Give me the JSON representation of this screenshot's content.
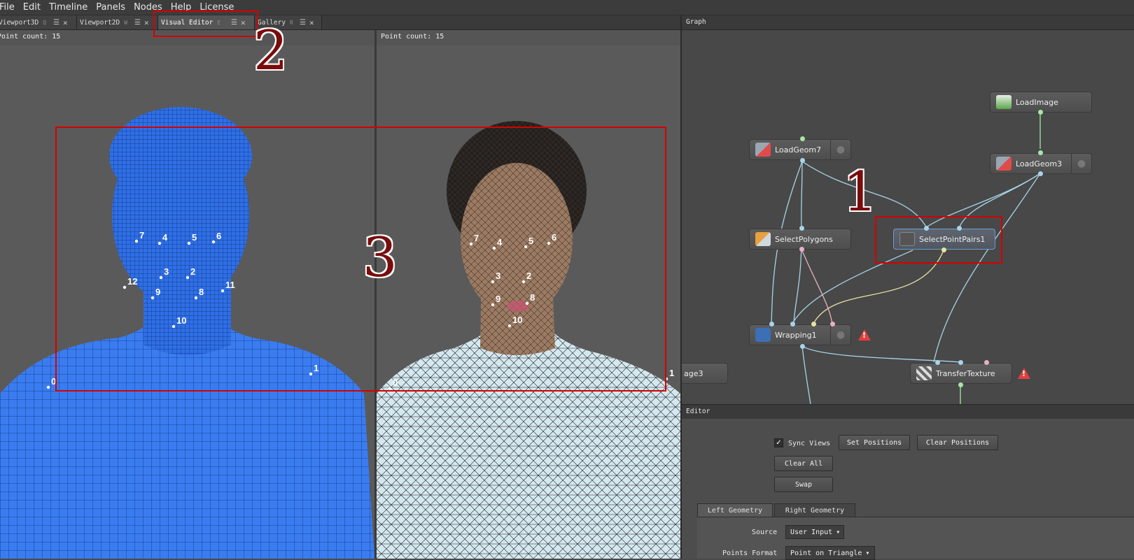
{
  "menubar": {
    "items": [
      "File",
      "Edit",
      "Timeline",
      "Panels",
      "Nodes",
      "Help",
      "License"
    ]
  },
  "tabs": [
    {
      "label": "Viewport3D",
      "key": "Q"
    },
    {
      "label": "Viewport2D",
      "key": "W"
    },
    {
      "label": "Visual Editor",
      "key": "E"
    },
    {
      "label": "Gallery",
      "key": "R"
    }
  ],
  "viewports": {
    "left": {
      "point_count": "Point count: 15"
    },
    "right": {
      "point_count": "Point count: 15"
    }
  },
  "left_points": [
    "7",
    "4",
    "5",
    "6",
    "3",
    "2",
    "12",
    "9",
    "8",
    "11",
    "10",
    "0",
    "1"
  ],
  "right_points": [
    "7",
    "4",
    "5",
    "6",
    "3",
    "2",
    "9",
    "8",
    "10",
    "0",
    "1"
  ],
  "graph": {
    "title": "Graph",
    "nodes": {
      "load_image": "LoadImage",
      "load_geom7": "LoadGeom7",
      "load_geom3": "LoadGeom3",
      "select_polygons": "SelectPolygons",
      "select_point_pairs": "SelectPointPairs1",
      "wrapping": "Wrapping1",
      "transfer_texture": "TransferTexture",
      "partial_node": "age3"
    },
    "warning_icon": "!"
  },
  "editor": {
    "title": "Editor",
    "sync_views_label": "Sync Views",
    "sync_views_checked": "✓",
    "set_positions": "Set Positions",
    "clear_positions": "Clear Positions",
    "clear_all": "Clear All",
    "swap": "Swap",
    "tabs": [
      "Left Geometry",
      "Right Geometry"
    ],
    "source_label": "Source",
    "source_value": "User Input",
    "points_format_label": "Points Format",
    "points_format_value": "Point on Triangle"
  },
  "annotations": [
    "1",
    "2",
    "3"
  ],
  "colors": {
    "annotation_red": "#d60000",
    "left_mesh": "#2f6fe6",
    "right_mesh": "#cfe4ee",
    "graph_bg": "#484848"
  }
}
